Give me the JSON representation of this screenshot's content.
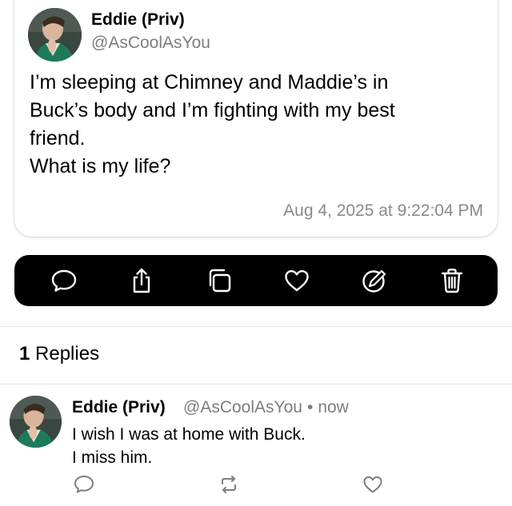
{
  "post": {
    "author_name": "Eddie (Priv)",
    "author_handle": "@AsCoolAsYou",
    "text_lines": [
      "I’m sleeping at Chimney and Maddie’s in",
      "Buck’s body and I’m fighting with my best",
      "friend.",
      "What is my life?"
    ],
    "timestamp": "Aug 4, 2025 at 9:22:04 PM"
  },
  "toolbar": {
    "actions": [
      {
        "name": "reply",
        "icon": "speech-bubble-icon"
      },
      {
        "name": "share",
        "icon": "share-icon"
      },
      {
        "name": "copy",
        "icon": "copy-icon"
      },
      {
        "name": "like",
        "icon": "heart-icon"
      },
      {
        "name": "edit",
        "icon": "edit-icon"
      },
      {
        "name": "delete",
        "icon": "trash-icon"
      }
    ]
  },
  "replies": {
    "count": "1",
    "label": "Replies",
    "items": [
      {
        "author_name": "Eddie (Priv)",
        "author_handle": "@AsCoolAsYou",
        "separator": "•",
        "time": "now",
        "text_lines": [
          "I wish I was at home with Buck.",
          "I miss him."
        ],
        "actions": [
          "speech-bubble-icon",
          "repost-icon",
          "heart-icon"
        ]
      }
    ]
  },
  "colors": {
    "toolbar_background": "#000000",
    "secondary_text": "#7d7d82",
    "timestamp_text": "#8a8a8e"
  }
}
